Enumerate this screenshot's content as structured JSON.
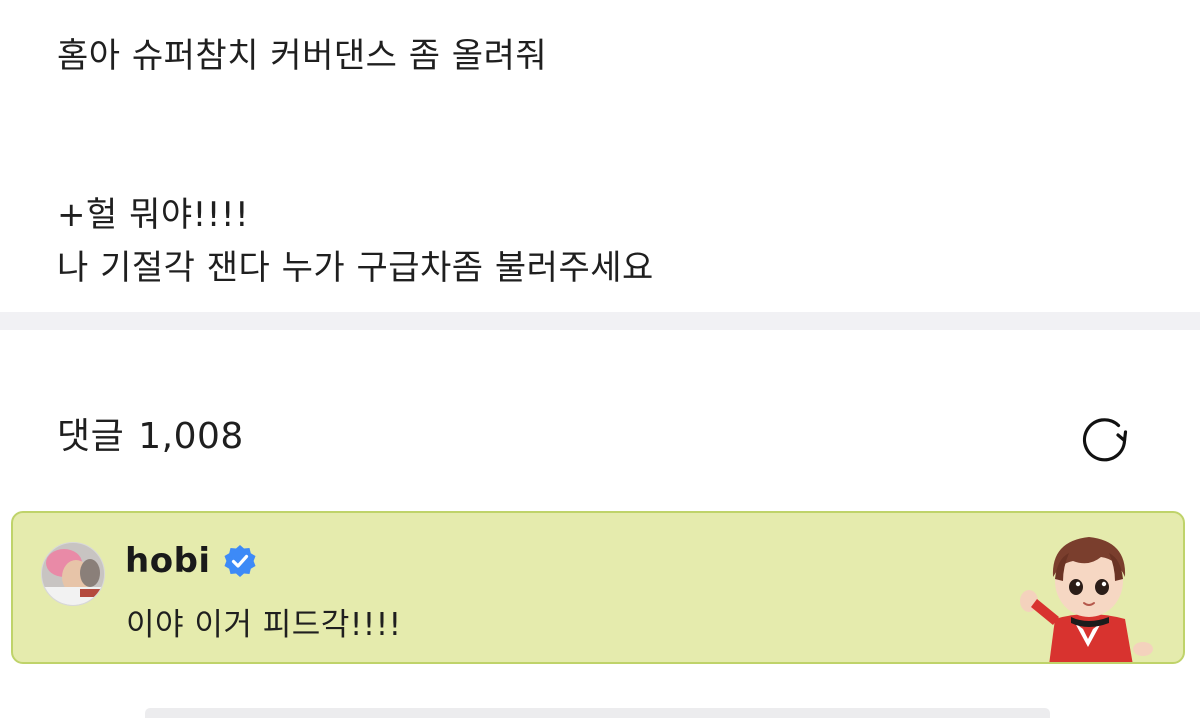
{
  "post": {
    "line1": "홈아 슈퍼참치 커버댄스 좀 올려줘",
    "line2": "+헐 뭐야!!!!",
    "line3": "나 기절각 잰다 누가 구급차좀 불러주세요"
  },
  "comments": {
    "label": "댓글",
    "count": "1,008",
    "refresh_icon": "refresh-icon"
  },
  "pinned_comment": {
    "author": "hobi",
    "verified_icon": "verified-badge-icon",
    "text": "이야 이거 피드각!!!!",
    "background_color": "#e5ebad",
    "border_color": "#bfd36a",
    "verified_color": "#3d8af7"
  }
}
